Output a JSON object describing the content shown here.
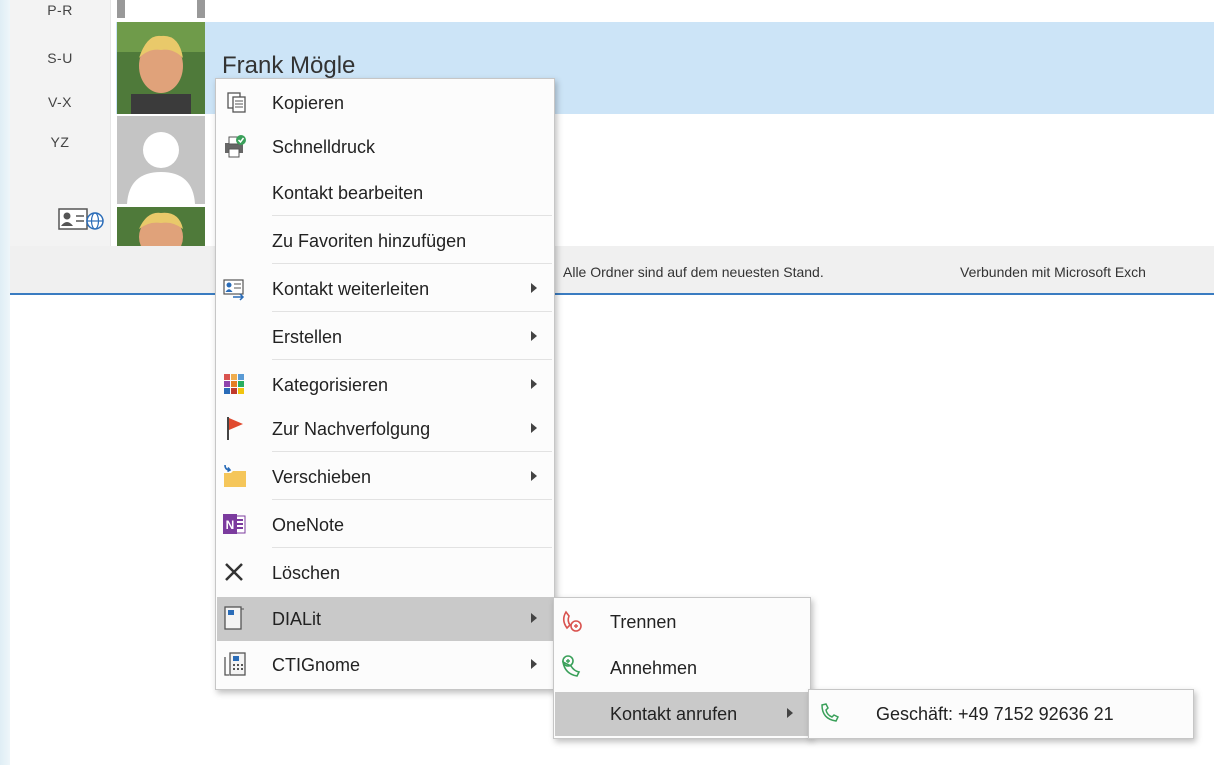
{
  "index_letters": [
    "P-R",
    "S-U",
    "V-X",
    "YZ"
  ],
  "contact_name": "Frank Mögle",
  "status_bar": {
    "folders": "Alle Ordner sind auf dem neuesten Stand.",
    "connection": "Verbunden mit Microsoft Exch"
  },
  "context_menu": {
    "items": [
      {
        "label": "Kopieren",
        "icon": "copy-icon"
      },
      {
        "label": "Schnelldruck",
        "icon": "quick-print-icon"
      },
      {
        "label": "Kontakt bearbeiten"
      },
      {
        "label": "Zu Favoriten hinzufügen"
      },
      {
        "label": "Kontakt weiterleiten",
        "icon": "forward-contact-icon",
        "submenu": true
      },
      {
        "label": "Erstellen",
        "submenu": true
      },
      {
        "label": "Kategorisieren",
        "icon": "categorize-icon",
        "submenu": true
      },
      {
        "label": "Zur Nachverfolgung",
        "icon": "flag-icon",
        "submenu": true
      },
      {
        "label": "Verschieben",
        "icon": "move-folder-icon",
        "submenu": true
      },
      {
        "label": "OneNote",
        "icon": "onenote-icon"
      },
      {
        "label": "Löschen",
        "icon": "delete-icon"
      },
      {
        "label": "DIALit",
        "icon": "dialit-icon",
        "submenu": true,
        "highlighted": true
      },
      {
        "label": "CTIGnome",
        "icon": "ctignome-icon",
        "submenu": true
      }
    ]
  },
  "dialit_submenu": {
    "items": [
      {
        "label": "Trennen",
        "icon": "hangup-icon"
      },
      {
        "label": "Annehmen",
        "icon": "answer-call-icon"
      },
      {
        "label": "Kontakt anrufen",
        "submenu": true,
        "highlighted": true
      }
    ]
  },
  "call_submenu": {
    "items": [
      {
        "label": "Geschäft: +49 7152 92636 21",
        "icon": "phone-icon"
      }
    ]
  },
  "colors": {
    "selection": "#cce4f7",
    "menu_highlight": "#c9c9c9",
    "status_accent": "#3a7cc1"
  }
}
